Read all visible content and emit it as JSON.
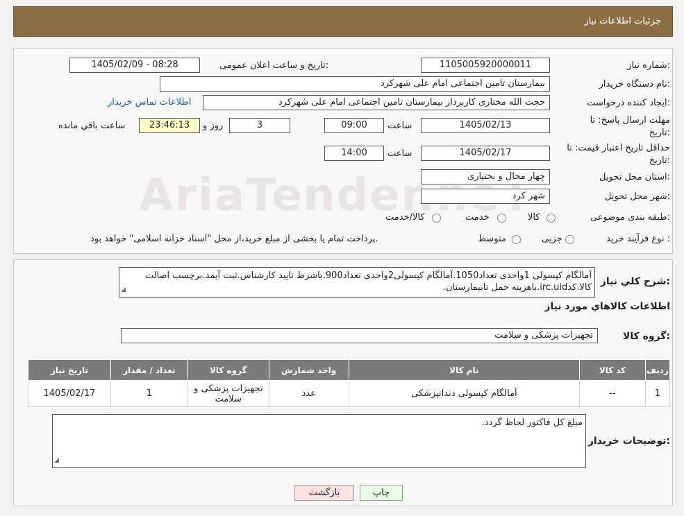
{
  "header": {
    "title": "جزئیات اطلاعات نیاز"
  },
  "form": {
    "need_number_label": "شماره نیاز:",
    "need_number": "1105005920000011",
    "announce_label": "تاریخ و ساعت اعلان عمومی:",
    "announce_value": "1405/02/09 - 08:28",
    "buyer_org_label": "نام دستگاه خریدار:",
    "buyer_org": "بیمارستان تامین اجتماعی امام علی شهرکرد",
    "creator_label": "ایجاد کننده درخواست:",
    "creator": "حجت الله مختاری کاربرداز بیمارستان تامین اجتماعی امام علی شهرکرد",
    "contact_link": "اطلاعات تماس خریدار",
    "deadline_label_1": "مهلت ارسال پاسخ: تا",
    "deadline_label_2": "تاریخ:",
    "deadline_date": "1405/02/13",
    "time_label": "ساعت",
    "deadline_time": "09:00",
    "days_value": "3",
    "days_label": "روز و",
    "remaining_time": "23:46:13",
    "remaining_label": "ساعت باقي مانده",
    "validity_label_1": "حداقل تاریخ اعتبار قیمت: تا",
    "validity_label_2": "تاریخ:",
    "validity_date": "1405/02/17",
    "validity_time": "14:00",
    "province_label": "استان محل تحویل:",
    "province": "چهار محال و بختیاری",
    "city_label": "شهر محل تحویل:",
    "city": "شهر کرد",
    "category_label": "طبقه بندی موضوعی:",
    "category_options": [
      "کالا",
      "خدمت",
      "کالا/خدمت"
    ],
    "process_label": "نوع فرآیند خرید :",
    "process_options": [
      "جزیی",
      "متوسط"
    ],
    "process_note": "پرداخت تمام یا بخشی از مبلغ خرید،از محل \"اسناد خزانه اسلامی\" خواهد بود."
  },
  "description": {
    "label": "شرح کلي نياز:",
    "text": "آمالگام کپسولی 1واحدی تعداد1050.آمالگام کپسولی2واحدی تعداد900.باشرط تایید کارشناس.ثبت آیمد.برچسب اصالت کالا.کدirc.uid.باهزینه حمل تابیمارستان."
  },
  "goods": {
    "section_title": "اطلاعات کالاهاي مورد نياز",
    "group_label": "گروه کالا:",
    "group_value": "تجهیزات پزشکی و سلامت",
    "columns": [
      "رديف",
      "کد کالا",
      "نام کالا",
      "واحد شمارش",
      "گروه کالا",
      "تعداد / مقدار",
      "تاريخ نياز"
    ],
    "rows": [
      [
        "1",
        "--",
        "آمالگام کپسولی دندانپزشکی",
        "عدد",
        "تجهیزات پزشکی و سلامت",
        "1",
        "1405/02/17"
      ]
    ]
  },
  "buyer_notes": {
    "label": "توضیحات خریدار:",
    "text": "مبلغ کل فاکتور لحاظ گردد."
  },
  "buttons": {
    "print": "چاپ",
    "back": "بازگشت"
  },
  "watermark": "AriaTender.neT"
}
